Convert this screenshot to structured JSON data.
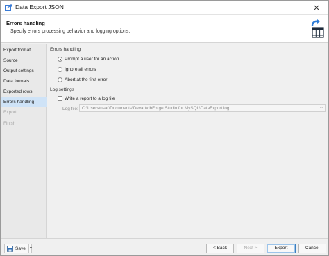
{
  "window": {
    "title": "Data Export JSON"
  },
  "header": {
    "title": "Errors handling",
    "subtitle": "Specify errors processing behavior and logging options."
  },
  "sidebar": {
    "items": [
      {
        "label": "Export format",
        "state": "normal"
      },
      {
        "label": "Source",
        "state": "normal"
      },
      {
        "label": "Output settings",
        "state": "normal"
      },
      {
        "label": "Data formats",
        "state": "normal"
      },
      {
        "label": "Exported rows",
        "state": "normal"
      },
      {
        "label": "Errors handling",
        "state": "active"
      },
      {
        "label": "Export",
        "state": "disabled"
      },
      {
        "label": "Finish",
        "state": "disabled"
      }
    ]
  },
  "errors_group": {
    "label": "Errors handling",
    "options": [
      {
        "label": "Prompt a user for an action",
        "checked": true
      },
      {
        "label": "Ignore all errors",
        "checked": false
      },
      {
        "label": "Abort at the first error",
        "checked": false
      }
    ]
  },
  "log_group": {
    "label": "Log settings",
    "write_report_label": "Write a report to a log file",
    "write_report_checked": false,
    "log_file_label": "Log file:",
    "log_file_value": "C:\\Users\\nsar\\Documents\\Devart\\dbForge Studio for MySQL\\DataExport.log",
    "browse_label": "..."
  },
  "footer": {
    "save_label": "Save",
    "back_label": "< Back",
    "next_label": "Next >",
    "export_label": "Export",
    "cancel_label": "Cancel"
  },
  "colors": {
    "accent": "#1a73c7",
    "selected_nav": "#cfe3f7"
  }
}
